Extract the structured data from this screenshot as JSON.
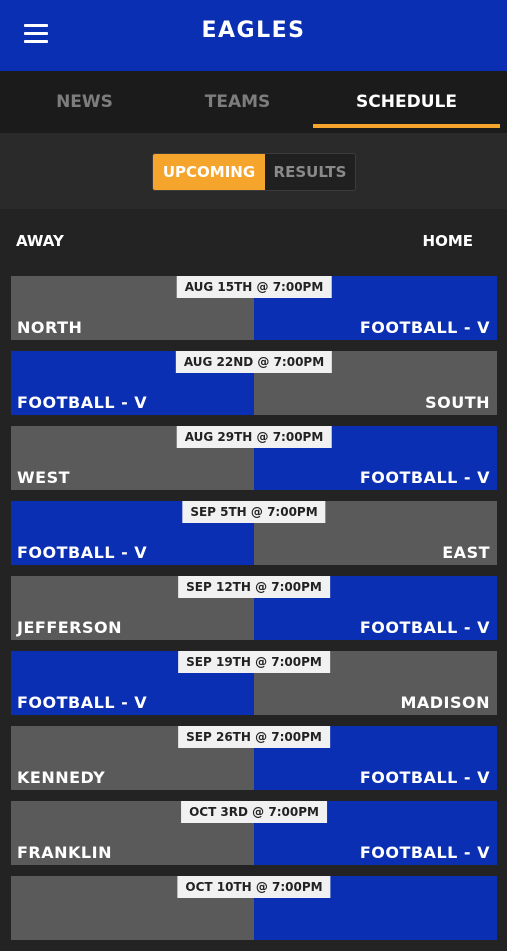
{
  "header": {
    "title": "EAGLES",
    "menu_icon": "hamburger-menu-icon"
  },
  "tabs": [
    {
      "label": "NEWS",
      "active": false
    },
    {
      "label": "TEAMS",
      "active": false
    },
    {
      "label": "SCHEDULE",
      "active": true
    }
  ],
  "segment": {
    "upcoming": "UPCOMING",
    "results": "RESULTS",
    "selected": "UPCOMING"
  },
  "columns": {
    "away": "AWAY",
    "home": "HOME"
  },
  "colors": {
    "blue": "#0a2fb3",
    "gray": "#5a5a5a",
    "accent": "#f5a52b"
  },
  "games": [
    {
      "date": "AUG 15TH @ 7:00PM",
      "away": "NORTH",
      "home": "FOOTBALL - V",
      "eagles_side": "home"
    },
    {
      "date": "AUG 22ND @ 7:00PM",
      "away": "FOOTBALL - V",
      "home": "SOUTH",
      "eagles_side": "away"
    },
    {
      "date": "AUG 29TH @ 7:00PM",
      "away": "WEST",
      "home": "FOOTBALL - V",
      "eagles_side": "home"
    },
    {
      "date": "SEP 5TH @ 7:00PM",
      "away": "FOOTBALL - V",
      "home": "EAST",
      "eagles_side": "away"
    },
    {
      "date": "SEP 12TH @ 7:00PM",
      "away": "JEFFERSON",
      "home": "FOOTBALL - V",
      "eagles_side": "home"
    },
    {
      "date": "SEP 19TH @ 7:00PM",
      "away": "FOOTBALL - V",
      "home": "MADISON",
      "eagles_side": "away"
    },
    {
      "date": "SEP 26TH @ 7:00PM",
      "away": "KENNEDY",
      "home": "FOOTBALL - V",
      "eagles_side": "home"
    },
    {
      "date": "OCT 3RD @ 7:00PM",
      "away": "FRANKLIN",
      "home": "FOOTBALL - V",
      "eagles_side": "home"
    },
    {
      "date": "OCT 10TH @ 7:00PM",
      "away": "",
      "home": "",
      "eagles_side": "home"
    }
  ]
}
